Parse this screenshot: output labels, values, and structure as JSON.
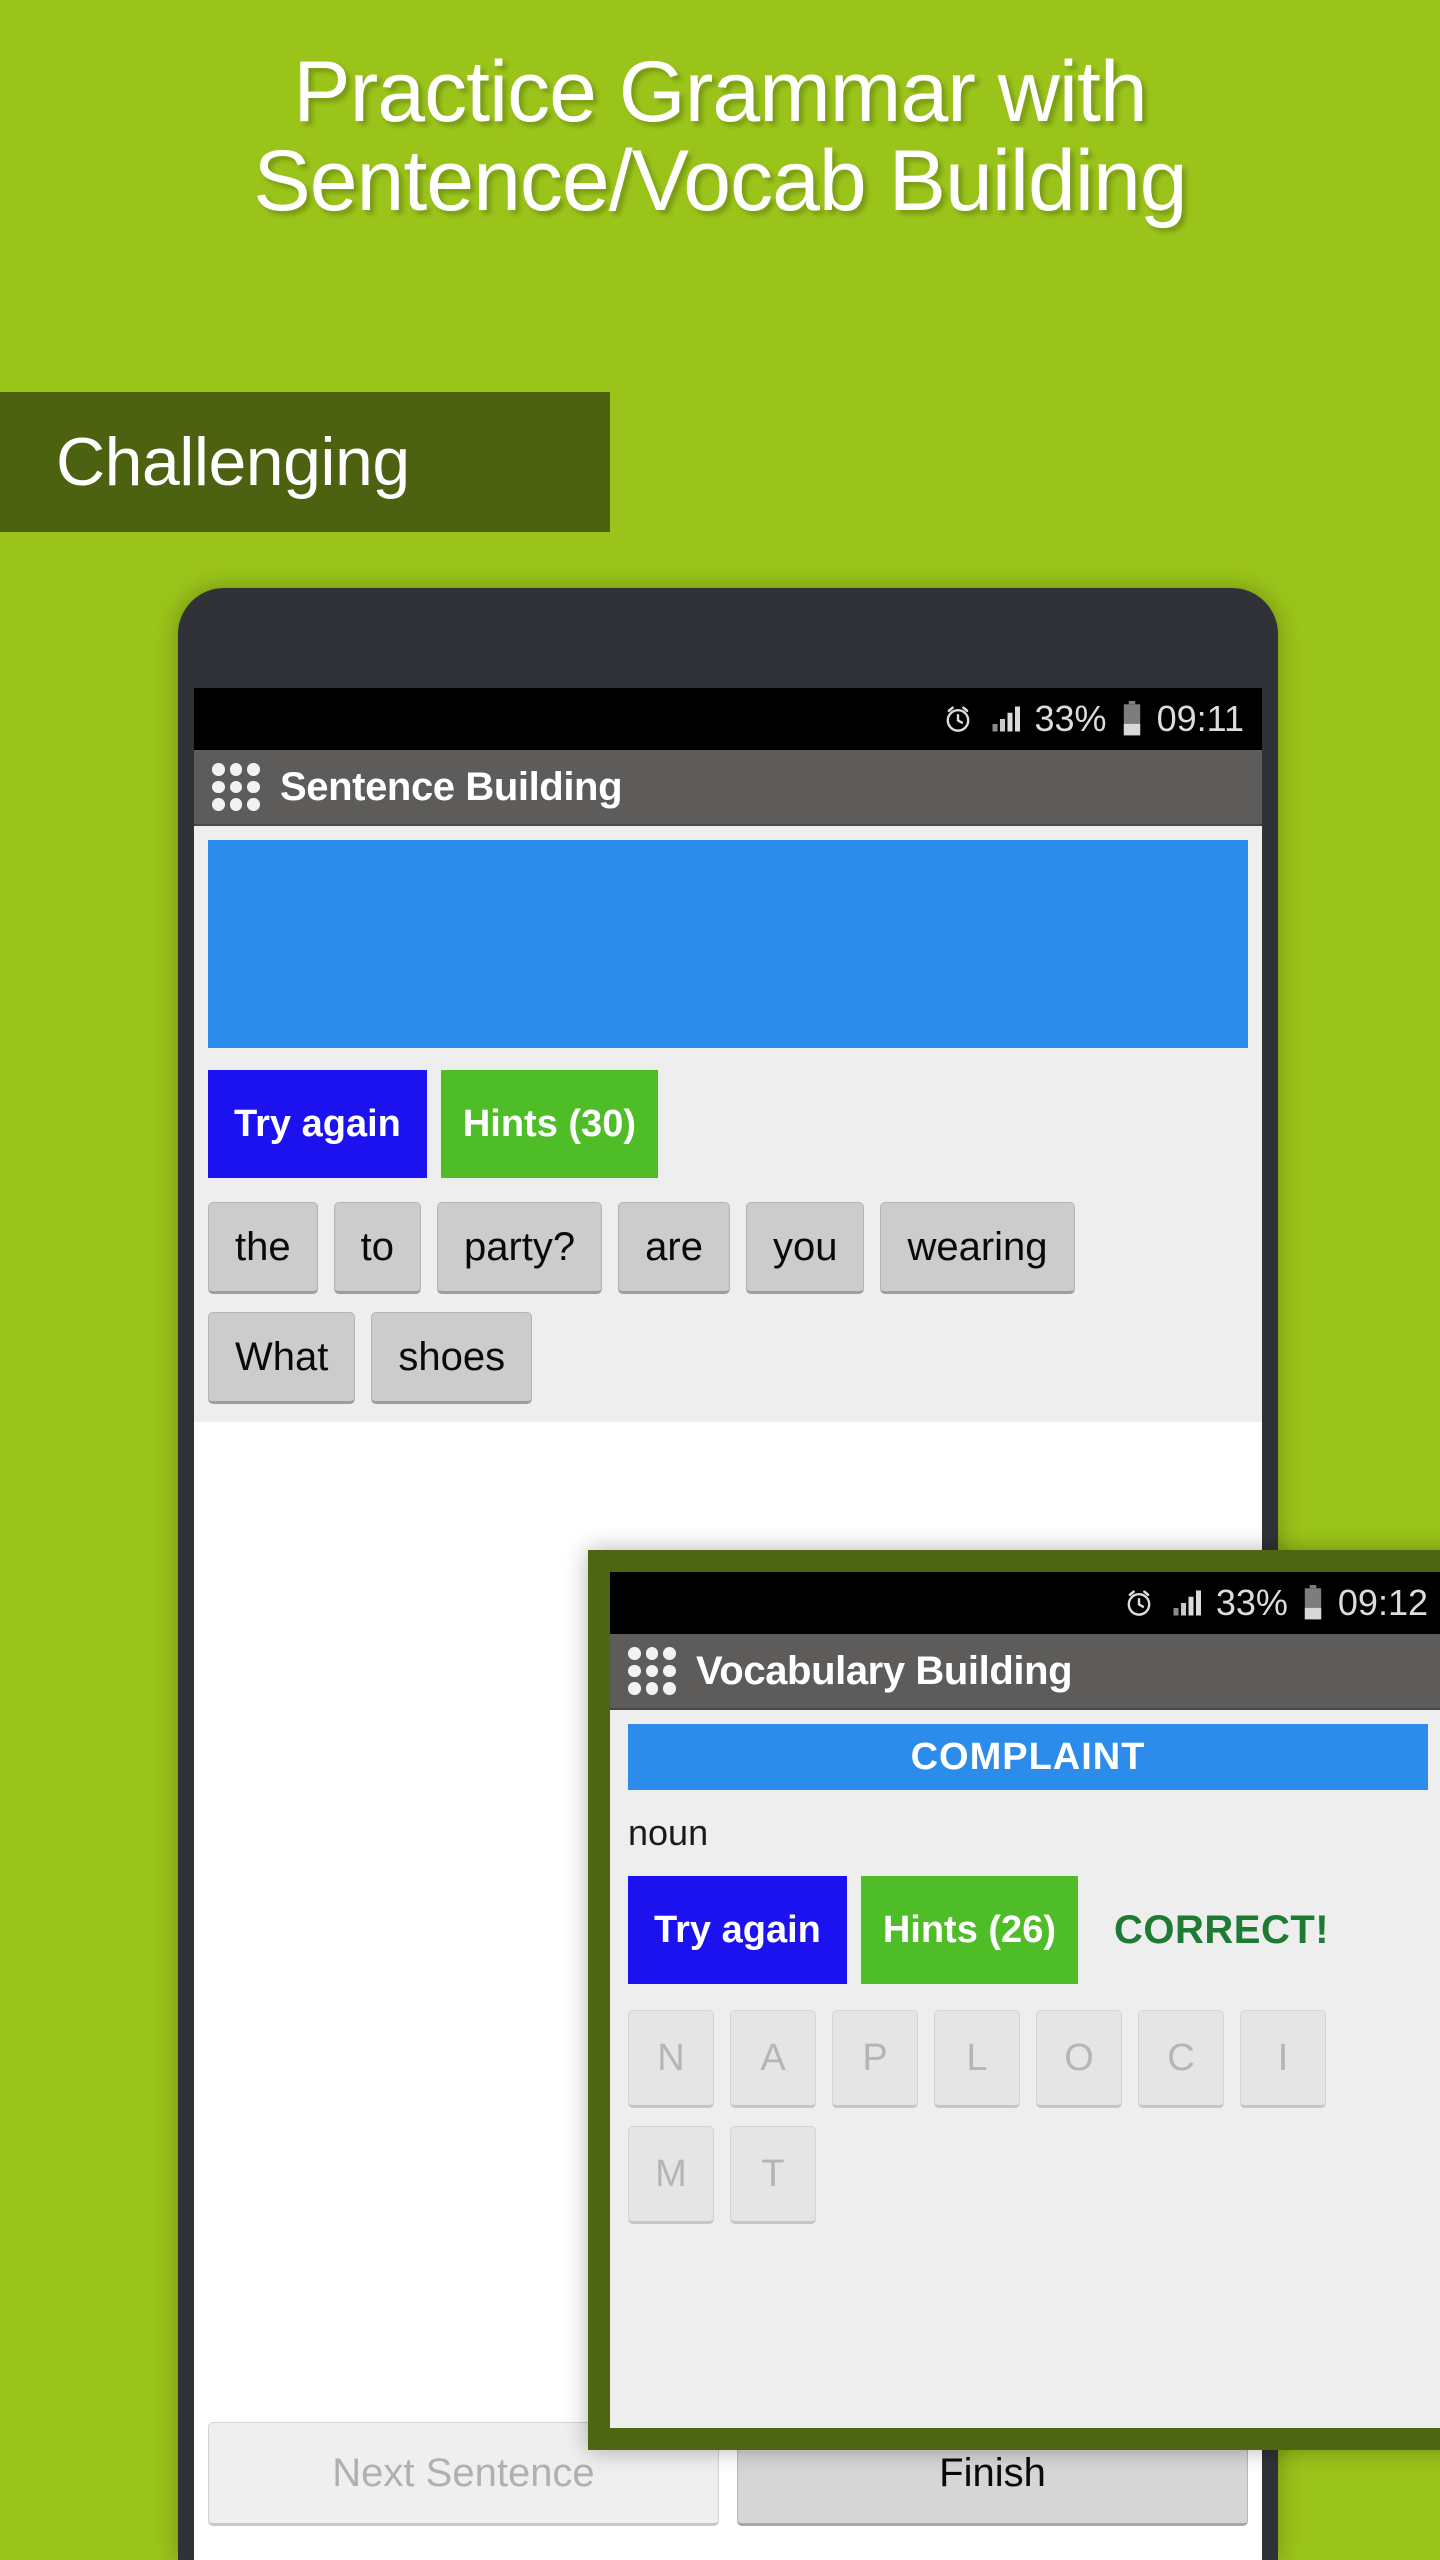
{
  "promo": {
    "headline_line1": "Practice Grammar with",
    "headline_line2": "Sentence/Vocab Building",
    "banner_label": "Challenging",
    "background_color": "#9ac41a",
    "banner_color": "#4d6211",
    "headline_color": "#ffffff"
  },
  "phone_one": {
    "status_bar": {
      "alarm_icon": "alarm-clock-icon",
      "signal_icon": "signal-bars-icon",
      "battery_percent": "33%",
      "battery_icon": "battery-icon",
      "time": "09:11"
    },
    "app_bar": {
      "menu_icon": "dot-grid-icon",
      "title": "Sentence Building"
    },
    "sentence_slot": {
      "text": "",
      "color": "#2b8ceb"
    },
    "actions": {
      "try_again_label": "Try again",
      "try_again_color": "#1b12ef",
      "hints_label": "Hints (30)",
      "hints_color": "#4fbd28"
    },
    "word_tiles": [
      "the",
      "to",
      "party?",
      "are",
      "you",
      "wearing",
      "What",
      "shoes"
    ],
    "bottom_buttons": [
      {
        "label": "Next Sentence",
        "state": "disabled"
      },
      {
        "label": "Finish",
        "state": "enabled"
      }
    ]
  },
  "phone_two": {
    "status_bar": {
      "alarm_icon": "alarm-clock-icon",
      "signal_icon": "signal-bars-icon",
      "battery_percent": "33%",
      "battery_icon": "battery-icon",
      "time": "09:12"
    },
    "app_bar": {
      "menu_icon": "dot-grid-icon",
      "title": "Vocabulary Building"
    },
    "word_banner": {
      "text": "COMPLAINT",
      "color": "#2b8ceb"
    },
    "part_of_speech": "noun",
    "actions": {
      "try_again_label": "Try again",
      "try_again_color": "#1b12ef",
      "hints_label": "Hints (26)",
      "hints_color": "#4fbd28",
      "status_label": "CORRECT!",
      "status_color": "#1f7a33"
    },
    "letter_tiles": [
      "N",
      "A",
      "P",
      "L",
      "O",
      "C",
      "I",
      "M",
      "T"
    ]
  }
}
